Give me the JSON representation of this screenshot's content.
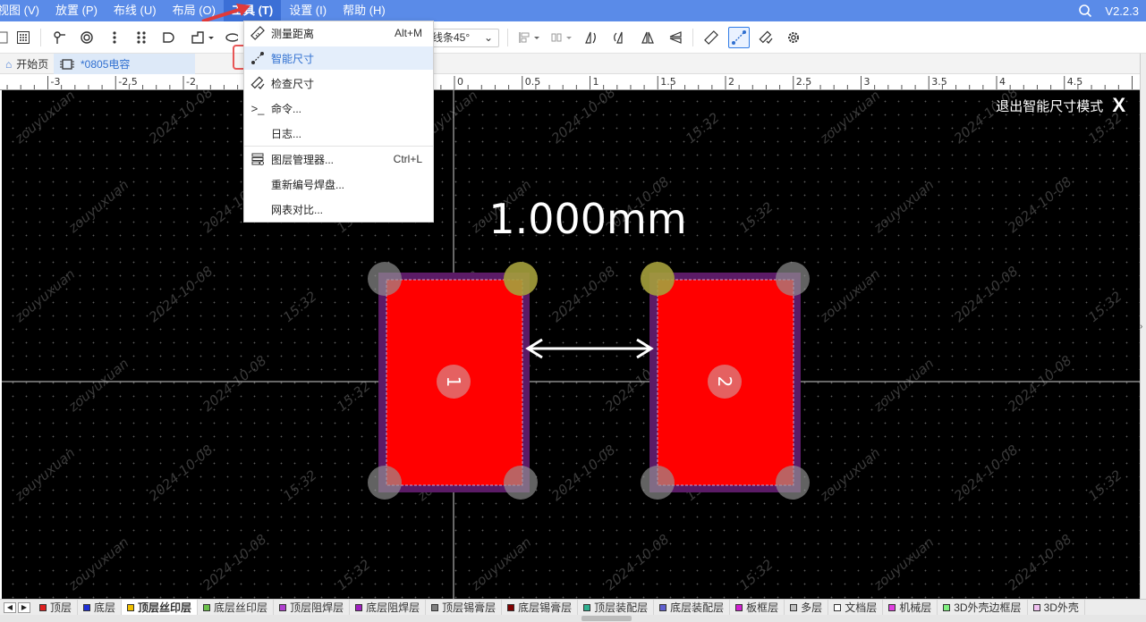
{
  "menubar": {
    "items": [
      "视图 (V)",
      "放置 (P)",
      "布线 (U)",
      "布局 (O)",
      "工具 (T)",
      "设置 (I)",
      "帮助 (H)"
    ],
    "version": "V2.2.3"
  },
  "toolbar": {
    "line_mode": "线条45°"
  },
  "tabs": {
    "home": "开始页",
    "doc": "*0805电容"
  },
  "ruler": {
    "labels": [
      "-3",
      "-2.5",
      "-2",
      "0",
      "0.5",
      "1",
      "1.5",
      "2",
      "2.5",
      "3",
      "3.5",
      "4",
      "4.5"
    ]
  },
  "canvas": {
    "exit_label": "退出智能尺寸模式",
    "exit_x": "X",
    "dimension_text": "1.000mm",
    "pad1_number": "1",
    "pad2_number": "2",
    "watermark_user": "zouyuxuan",
    "watermark_date": "2024-10-08",
    "watermark_time": "15:32"
  },
  "tools_menu": {
    "items": [
      {
        "label": "测量距离",
        "shortcut": "Alt+M",
        "icon": "ruler-icon"
      },
      {
        "label": "智能尺寸",
        "shortcut": "",
        "icon": "smart-dimension-icon"
      },
      {
        "label": "检查尺寸",
        "shortcut": "",
        "icon": "check-dimension-icon"
      },
      {
        "label": "命令...",
        "shortcut": "",
        "icon": "terminal-icon"
      },
      {
        "label": "日志...",
        "shortcut": "",
        "icon": ""
      },
      {
        "label": "图层管理器...",
        "shortcut": "Ctrl+L",
        "icon": "layers-icon"
      },
      {
        "label": "重新编号焊盘...",
        "shortcut": "",
        "icon": ""
      },
      {
        "label": "网表对比...",
        "shortcut": "",
        "icon": ""
      }
    ]
  },
  "layers": [
    {
      "name": "顶层",
      "color": "#e02020"
    },
    {
      "name": "底层",
      "color": "#1f2fd6"
    },
    {
      "name": "顶层丝印层",
      "color": "#f0c000"
    },
    {
      "name": "底层丝印层",
      "color": "#6ac04a"
    },
    {
      "name": "顶层阻焊层",
      "color": "#b040d0"
    },
    {
      "name": "底层阻焊层",
      "color": "#a020c0"
    },
    {
      "name": "顶层锡膏层",
      "color": "#808080"
    },
    {
      "name": "底层锡膏层",
      "color": "#800000"
    },
    {
      "name": "顶层装配层",
      "color": "#30b090"
    },
    {
      "name": "底层装配层",
      "color": "#6060d0"
    },
    {
      "name": "板框层",
      "color": "#d020d0"
    },
    {
      "name": "多层",
      "color": "#c0c0c0"
    },
    {
      "name": "文档层",
      "color": "#ffffff"
    },
    {
      "name": "机械层",
      "color": "#e040e0"
    },
    {
      "name": "3D外壳边框层",
      "color": "#80f080"
    },
    {
      "name": "3D外壳",
      "color": "#f0c0f0"
    }
  ]
}
